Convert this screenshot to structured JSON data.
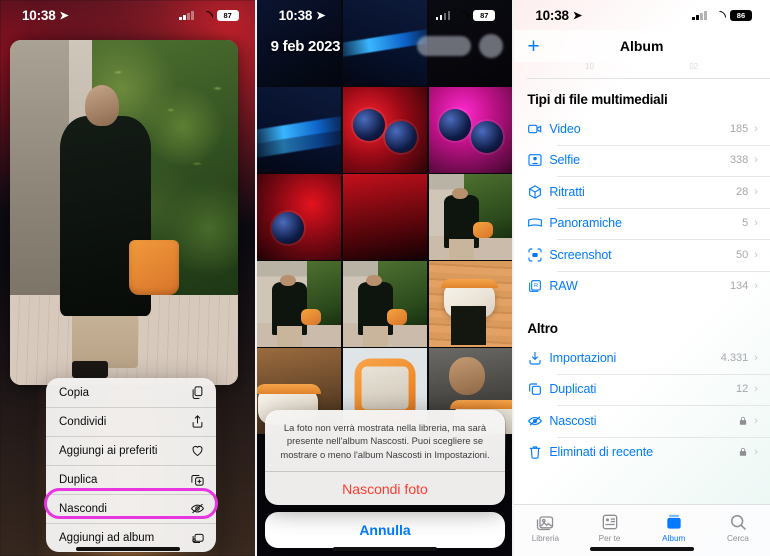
{
  "panel1": {
    "status": {
      "time": "10:38",
      "battery": "87",
      "location_icon": "location-arrow-icon"
    },
    "context_menu": [
      {
        "label": "Copia",
        "icon": "copy-icon"
      },
      {
        "label": "Condividi",
        "icon": "share-icon"
      },
      {
        "label": "Aggiungi ai preferiti",
        "icon": "heart-icon"
      },
      {
        "label": "Duplica",
        "icon": "duplicate-icon"
      },
      {
        "label": "Nascondi",
        "icon": "eye-slash-icon",
        "highlighted": true
      },
      {
        "label": "Aggiungi ad album",
        "icon": "add-to-album-icon"
      }
    ]
  },
  "panel2": {
    "status": {
      "time": "10:38",
      "battery": "87",
      "location_icon": "location-arrow-icon"
    },
    "date_header": "9 feb 2023",
    "action_sheet": {
      "message": "La foto non verrà mostrata nella libreria, ma sarà presente nell'album Nascosti. Puoi scegliere se mostrare o meno l'album Nascosti in Impostazioni.",
      "destructive_label": "Nascondi foto",
      "cancel_label": "Annulla",
      "destructive_color": "#ff3b30",
      "cancel_color": "#027aff"
    }
  },
  "panel3": {
    "status": {
      "time": "10:38",
      "battery": "86",
      "location_icon": "location-arrow-icon"
    },
    "nav": {
      "add_label": "+",
      "title": "Album"
    },
    "ghost_row": {
      "left": "10",
      "right": "02"
    },
    "sections": [
      {
        "title": "Tipi di file multimediali",
        "rows": [
          {
            "label": "Video",
            "count": "185",
            "icon": "video-camera-icon",
            "lock": false
          },
          {
            "label": "Selfie",
            "count": "338",
            "icon": "selfie-icon",
            "lock": false
          },
          {
            "label": "Ritratti",
            "count": "28",
            "icon": "cube-icon",
            "lock": false
          },
          {
            "label": "Panoramiche",
            "count": "5",
            "icon": "panorama-icon",
            "lock": false
          },
          {
            "label": "Screenshot",
            "count": "50",
            "icon": "screenshot-icon",
            "lock": false
          },
          {
            "label": "RAW",
            "count": "134",
            "icon": "raw-icon",
            "lock": false
          }
        ]
      },
      {
        "title": "Altro",
        "rows": [
          {
            "label": "Importazioni",
            "count": "4.331",
            "icon": "import-icon",
            "lock": false
          },
          {
            "label": "Duplicati",
            "count": "12",
            "icon": "duplicate-icon",
            "lock": false
          },
          {
            "label": "Nascosti",
            "count": "",
            "icon": "eye-slash-icon",
            "lock": true,
            "highlighted": true
          },
          {
            "label": "Eliminati di recente",
            "count": "",
            "icon": "trash-icon",
            "lock": true
          }
        ]
      }
    ],
    "tabs": [
      {
        "label": "Libreria",
        "icon": "photos-library-icon",
        "active": false
      },
      {
        "label": "Per te",
        "icon": "for-you-icon",
        "active": false
      },
      {
        "label": "Album",
        "icon": "albums-icon",
        "active": true
      },
      {
        "label": "Cerca",
        "icon": "search-icon",
        "active": false
      }
    ]
  },
  "theme": {
    "ios_blue": "#027aff",
    "highlight_magenta": "#e736e0",
    "destructive_red": "#ff3b30",
    "secondary_gray": "#a7a7ac"
  }
}
